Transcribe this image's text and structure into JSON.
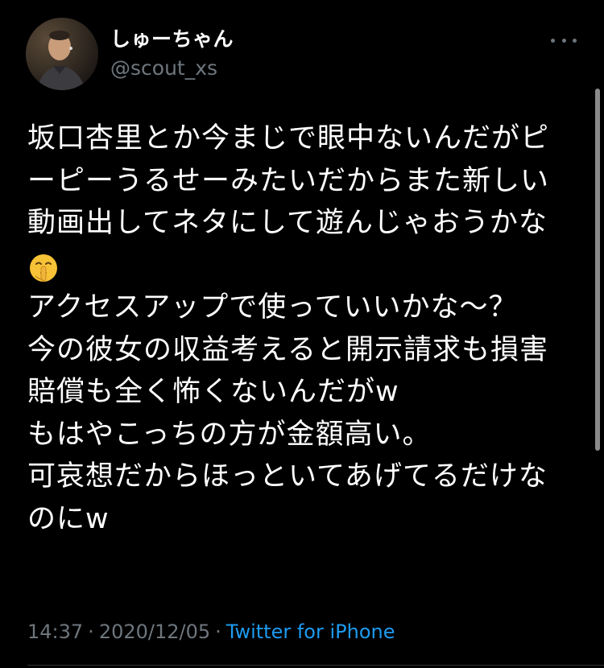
{
  "tweet": {
    "author": {
      "display_name": "しゅーちゃん",
      "handle": "@scout_xs",
      "avatar_icon": "user-avatar-photo"
    },
    "more_icon": "more-horizontal-icon",
    "text_lines": [
      "坂口杏里とか今まじで眼中ないんだがピ",
      "ーピーうるせーみたいだからまた新しい",
      "動画出してネタにして遊んじゃおうかな",
      "🤫",
      "アクセスアップで使っていいかな〜？",
      "今の彼女の収益考えると開示請求も損害",
      "賠償も全く怖くないんだがw",
      "もはやこっちの方が金額高い。",
      "可哀想だからほっといてあげてるだけな",
      "のにw"
    ],
    "emoji_icon": "shushing-face-emoji",
    "meta": {
      "time": "14:37",
      "separator": "·",
      "date": "2020/12/05",
      "source": "Twitter for iPhone"
    }
  },
  "colors": {
    "background": "#000000",
    "text_primary": "#ffffff",
    "text_secondary": "#6e767d",
    "link": "#1d9bf0",
    "divider": "#2f3336",
    "emoji_face": "#f7c236"
  }
}
